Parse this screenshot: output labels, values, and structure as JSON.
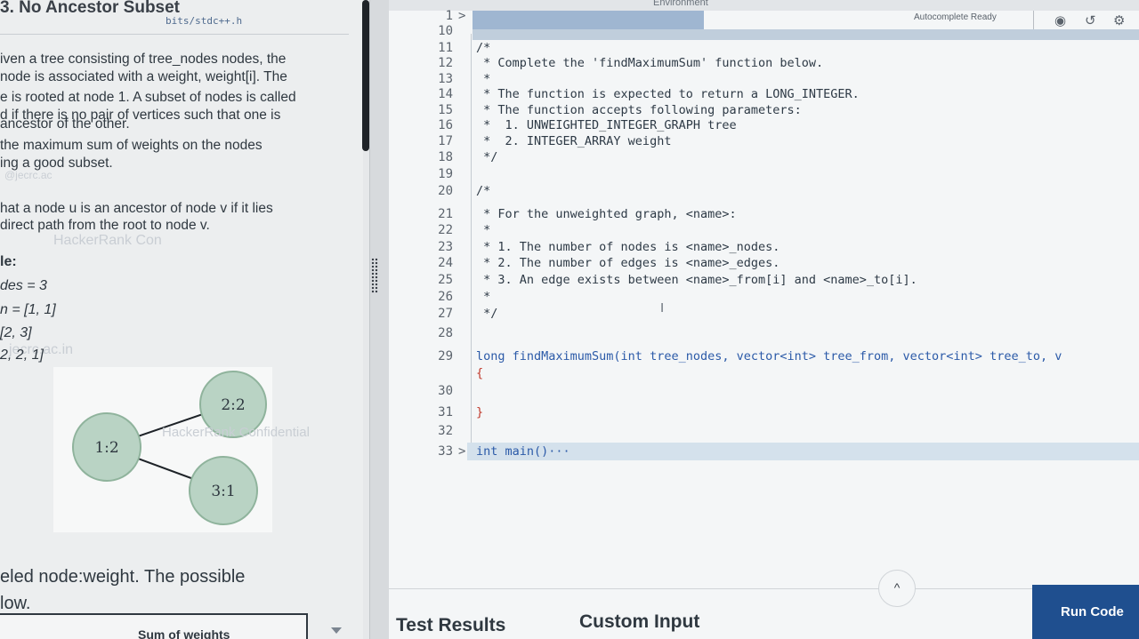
{
  "problem": {
    "title": "3. No Ancestor Subset",
    "paragraphs": [
      "iven a tree consisting of tree_nodes nodes, the",
      "node is associated with a weight, weight[i]. The",
      "e is rooted at node 1. A subset of nodes is called",
      "d if there is no pair of vertices such that one is",
      "ancestor of the other.",
      " the maximum sum of weights on the nodes",
      "ing a good subset.",
      "hat a node u is an ancestor of node v if it lies",
      "direct path from the root to node v."
    ],
    "example_label": "le:",
    "example_rows": [
      "des = 3",
      "n = [1, 1]",
      "[2, 3]",
      "2, 2, 1]"
    ],
    "watermarks": [
      "HackerRank Confidential",
      "@jecrc.ac",
      "HackerRank Con",
      "jecrc.ac.in"
    ],
    "graph_nodes": [
      "1:2",
      "2:2",
      "3:1"
    ],
    "caption_line1": "eled node:weight. The possible",
    "caption_line2": "low.",
    "table_header": "Sum of weights"
  },
  "editor": {
    "environment_label": "Environment",
    "autocomplete_label": "Autocomplete Ready",
    "file_tab": "bits/stdc++.h",
    "lines": [
      {
        "n": "1",
        "fold": ">",
        "text": ""
      },
      {
        "n": "10",
        "fold": "",
        "text": ""
      },
      {
        "n": "11",
        "fold": "",
        "text": "/*"
      },
      {
        "n": "12",
        "fold": "",
        "text": " * Complete the 'findMaximumSum' function below."
      },
      {
        "n": "13",
        "fold": "",
        "text": " *"
      },
      {
        "n": "14",
        "fold": "",
        "text": " * The function is expected to return a LONG_INTEGER."
      },
      {
        "n": "15",
        "fold": "",
        "text": " * The function accepts following parameters:"
      },
      {
        "n": "16",
        "fold": "",
        "text": " *  1. UNWEIGHTED_INTEGER_GRAPH tree"
      },
      {
        "n": "17",
        "fold": "",
        "text": " *  2. INTEGER_ARRAY weight"
      },
      {
        "n": "18",
        "fold": "",
        "text": " */"
      },
      {
        "n": "19",
        "fold": "",
        "text": ""
      },
      {
        "n": "20",
        "fold": "",
        "text": "/*"
      },
      {
        "n": "21",
        "fold": "",
        "text": " * For the unweighted graph, <name>:"
      },
      {
        "n": "22",
        "fold": "",
        "text": " *"
      },
      {
        "n": "23",
        "fold": "",
        "text": " * 1. The number of nodes is <name>_nodes."
      },
      {
        "n": "24",
        "fold": "",
        "text": " * 2. The number of edges is <name>_edges."
      },
      {
        "n": "25",
        "fold": "",
        "text": " * 3. An edge exists between <name>_from[i] and <name>_to[i]."
      },
      {
        "n": "26",
        "fold": "",
        "text": " *"
      },
      {
        "n": "27",
        "fold": "",
        "text": " */"
      },
      {
        "n": "28",
        "fold": "",
        "text": ""
      },
      {
        "n": "29",
        "fold": "",
        "text": "long findMaximumSum(int tree_nodes, vector<int> tree_from, vector<int> tree_to, v"
      },
      {
        "n": "",
        "fold": "",
        "text": "{"
      },
      {
        "n": "30",
        "fold": "",
        "text": ""
      },
      {
        "n": "31",
        "fold": "",
        "text": "}"
      },
      {
        "n": "32",
        "fold": "",
        "text": ""
      },
      {
        "n": "33",
        "fold": ">",
        "text": "int main()···"
      }
    ]
  },
  "bottom": {
    "tab_test_results": "Test Results",
    "tab_custom_input": "Custom Input",
    "run_code": "Run Code",
    "collapse_glyph": "^"
  },
  "colors": {
    "accent": "#1f4f8f",
    "keyword": "#2b5aa8"
  }
}
